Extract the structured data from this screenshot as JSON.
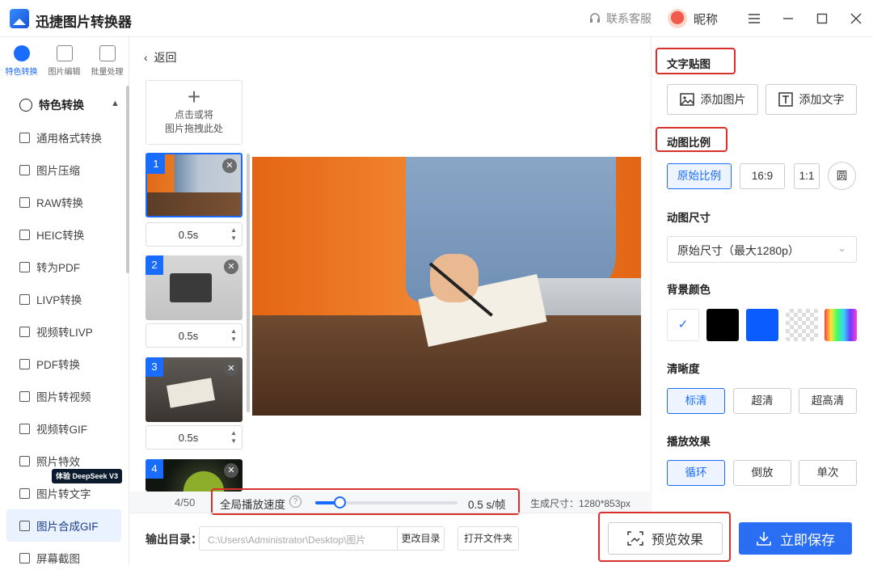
{
  "app": {
    "title": "迅捷图片转换器"
  },
  "header": {
    "support": "联系客服",
    "nickname": "昵称"
  },
  "topnav": [
    {
      "label": "特色转换",
      "icon": "convert-icon",
      "active": true
    },
    {
      "label": "图片编辑",
      "icon": "image-edit-icon",
      "active": false
    },
    {
      "label": "批量处理",
      "icon": "batch-icon",
      "active": false
    }
  ],
  "sidebar": {
    "section_title": "特色转换",
    "items": [
      {
        "label": "通用格式转换"
      },
      {
        "label": "图片压缩"
      },
      {
        "label": "RAW转换"
      },
      {
        "label": "HEIC转换"
      },
      {
        "label": "转为PDF"
      },
      {
        "label": "LIVP转换"
      },
      {
        "label": "视频转LIVP"
      },
      {
        "label": "PDF转换"
      },
      {
        "label": "图片转视频"
      },
      {
        "label": "视频转GIF"
      },
      {
        "label": "照片特效"
      },
      {
        "label": "图片转文字"
      },
      {
        "label": "图片合成GIF",
        "active": true
      },
      {
        "label": "屏幕截图"
      }
    ],
    "badge": "体验 DeepSeek V3"
  },
  "main": {
    "back": "返回",
    "add_hint_1": "点击或将",
    "add_hint_2": "图片拖拽此处",
    "frames": [
      {
        "num": "1",
        "duration": "0.5s"
      },
      {
        "num": "2",
        "duration": "0.5s"
      },
      {
        "num": "3",
        "duration": "0.5s"
      },
      {
        "num": "4",
        "duration": ""
      }
    ],
    "page_count": "4/50",
    "speed_label": "全局播放速度",
    "speed_value": "0.5 s/帧",
    "speed_fraction": 0.17,
    "gen_size": "生成尺寸：1280*853px"
  },
  "output": {
    "label": "输出目录：",
    "path": "C:\\Users\\Administrator\\Desktop\\图片",
    "change_dir": "更改目录",
    "open_folder": "打开文件夹"
  },
  "panel": {
    "text_sticker": "文字贴图",
    "add_image": "添加图片",
    "add_text": "添加文字",
    "ratio_title": "动图比例",
    "ratios": [
      "原始比例",
      "16:9",
      "1:1",
      "圆"
    ],
    "size_title": "动图尺寸",
    "size_value": "原始尺寸（最大1280p）",
    "bg_title": "背景颜色",
    "bg_colors": {
      "white": "#ffffff",
      "black": "#000000",
      "blue": "#0a5cff"
    },
    "clarity_title": "清晰度",
    "clarity": [
      "标清",
      "超清",
      "超高清"
    ],
    "play_title": "播放效果",
    "play": [
      "循环",
      "倒放",
      "单次"
    ]
  },
  "actions": {
    "preview": "预览效果",
    "save": "立即保存"
  },
  "colors": {
    "accent": "#1a6cff",
    "highlight": "#d9302c"
  }
}
